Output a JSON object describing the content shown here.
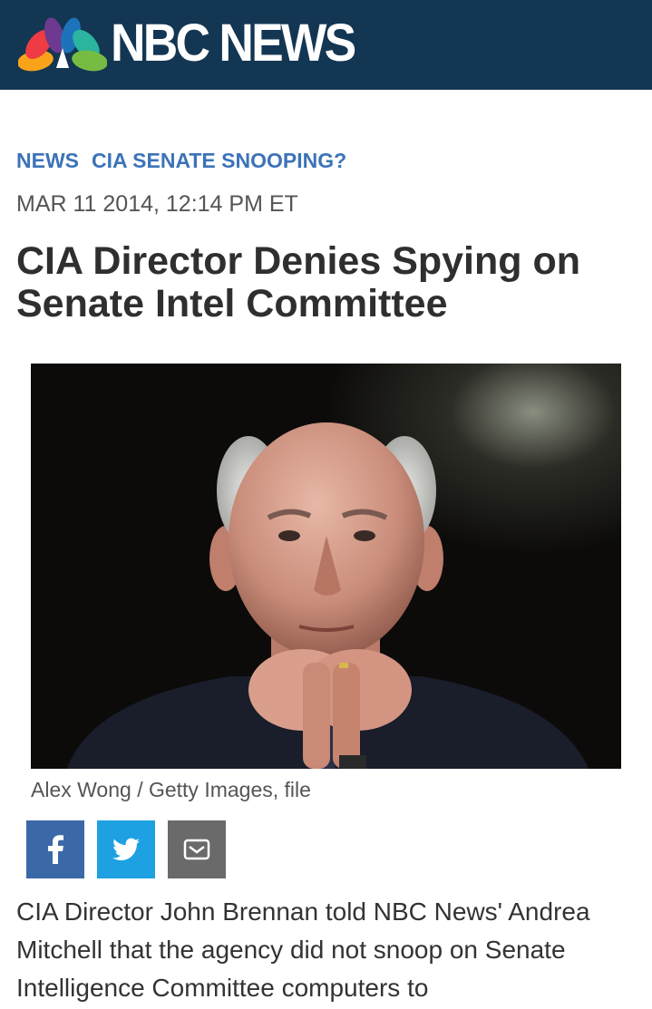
{
  "header": {
    "brand": "NBC NEWS",
    "background_color": "#133653",
    "logo_icon": "nbc-peacock-icon"
  },
  "breadcrumb": {
    "section": "NEWS",
    "topic": "CIA SENATE SNOOPING?"
  },
  "article": {
    "dateline": "MAR 11 2014, 12:14 PM ET",
    "headline": "CIA Director Denies Spying on Senate Intel Committee",
    "photo_caption": "Alex Wong / Getty Images, file",
    "body": "CIA Director John Brennan told NBC News' Andrea Mitchell that the agency did not snoop on Senate Intelligence Committee computers to"
  },
  "share": {
    "buttons": [
      {
        "name": "facebook",
        "icon": "facebook-icon",
        "color": "#3b69a8"
      },
      {
        "name": "twitter",
        "icon": "twitter-icon",
        "color": "#1da1e2"
      },
      {
        "name": "email",
        "icon": "email-icon",
        "color": "#6a6a6a"
      }
    ]
  },
  "colors": {
    "link_blue": "#3c73b8",
    "headline": "#2f2f2f",
    "meta_gray": "#555555"
  }
}
